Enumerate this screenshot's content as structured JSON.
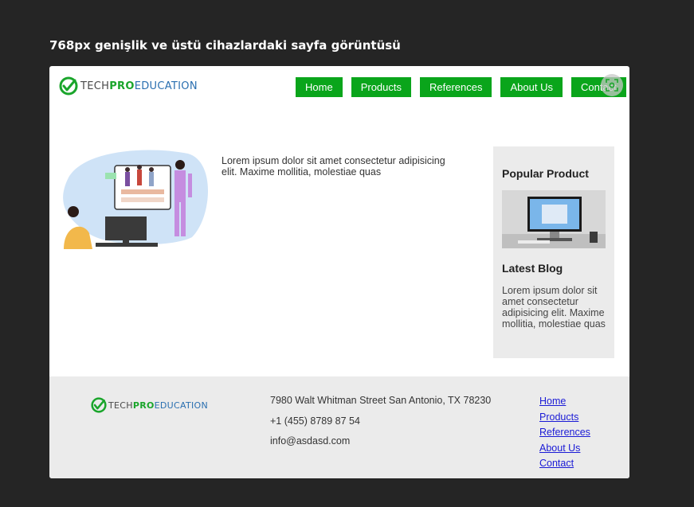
{
  "caption": "768px genişlik ve üstü cihazlardaki sayfa görüntüsü",
  "brand": {
    "part1": "TECH",
    "part2": "PRO",
    "part3": "EDUCATION"
  },
  "nav": [
    "Home",
    "Products",
    "References",
    "About Us",
    "Contact"
  ],
  "hero": {
    "text": "Lorem ipsum dolor sit amet consectetur adipisicing elit. Maxime mollitia, molestiae quas"
  },
  "aside": {
    "popular_title": "Popular Product",
    "blog_title": "Latest Blog",
    "blog_text": "Lorem ipsum dolor sit amet consectetur adipisicing elit. Maxime mollitia, molestiae quas"
  },
  "footer": {
    "address": "7980 Walt Whitman Street San Antonio, TX 78230",
    "phone": "+1 (455) 8789 87 54",
    "email": "info@asdasd.com",
    "links": [
      "Home",
      "Products",
      "References",
      "About Us",
      "Contact"
    ]
  },
  "colors": {
    "accent": "#0aa51b",
    "background": "#252525",
    "panel": "#ebebeb",
    "link": "#1a1ad6"
  },
  "icons": [
    "checkmark-logo-icon",
    "scan-icon"
  ]
}
